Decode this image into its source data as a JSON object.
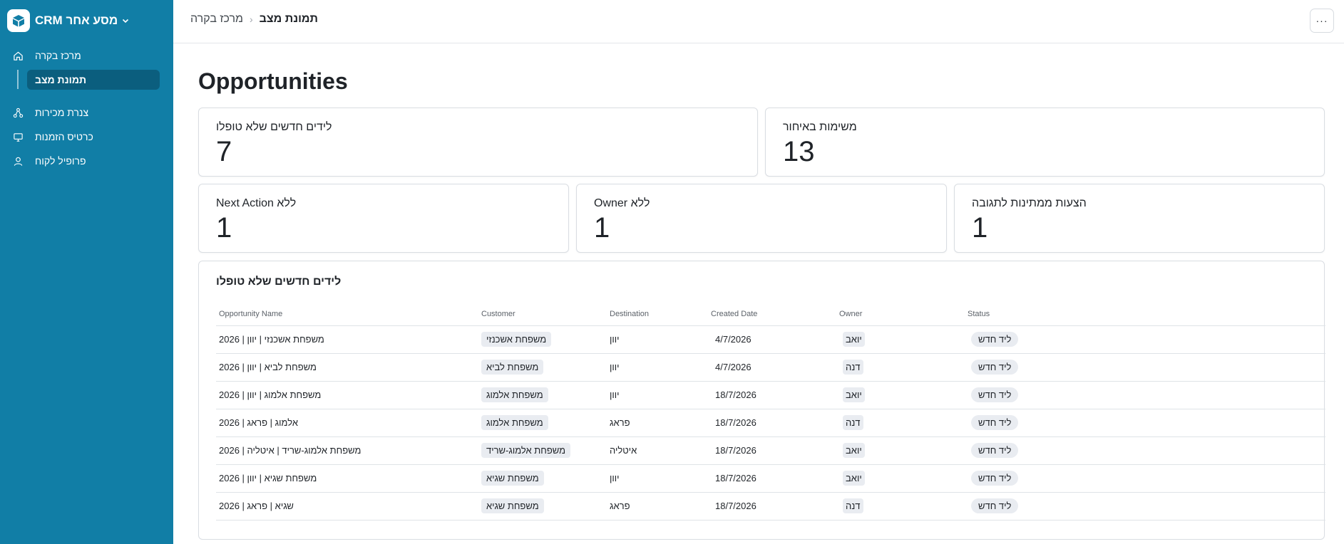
{
  "app": {
    "name": "CRM מסע אחר"
  },
  "sidebar": {
    "items": [
      {
        "label": "מרכז בקרה",
        "icon": "home-icon"
      },
      {
        "label": "תמונת מצב",
        "icon": "",
        "active": true
      },
      {
        "label": "צנרת מכירות",
        "icon": "pipeline-icon"
      },
      {
        "label": "כרטיס הזמנות",
        "icon": "monitor-icon"
      },
      {
        "label": "פרופיל לקוח",
        "icon": "user-icon"
      }
    ]
  },
  "header": {
    "breadcrumb_parent": "מרכז בקרה",
    "breadcrumb_current": "תמונת מצב",
    "more_label": "···"
  },
  "main": {
    "title": "Opportunities",
    "kpis": [
      {
        "label": "לידים חדשים שלא טופלו",
        "value": "7"
      },
      {
        "label": "משימות באיחור",
        "value": "13"
      },
      {
        "label": "ללא Next Action",
        "value": "1"
      },
      {
        "label": "ללא Owner",
        "value": "1"
      },
      {
        "label": "הצעות ממתינות לתגובה",
        "value": "1"
      }
    ],
    "table": {
      "title": "לידים חדשים שלא טופלו",
      "columns": [
        "Opportunity Name",
        "Customer",
        "Destination",
        "Created Date",
        "Owner",
        "Status"
      ],
      "rows": [
        {
          "name": "משפחת אשכנזי | יוון | 2026",
          "customer": "משפחת אשכנזי",
          "destination": "יוון",
          "created": "4/7/2026",
          "owner": "יואב",
          "status": "ליד חדש"
        },
        {
          "name": "משפחת לביא | יוון | 2026",
          "customer": "משפחת לביא",
          "destination": "יוון",
          "created": "4/7/2026",
          "owner": "דנה",
          "status": "ליד חדש"
        },
        {
          "name": "משפחת אלמוג | יוון | 2026",
          "customer": "משפחת אלמוג",
          "destination": "יוון",
          "created": "18/7/2026",
          "owner": "יואב",
          "status": "ליד חדש"
        },
        {
          "name": "אלמוג | פראג | 2026",
          "customer": "משפחת אלמוג",
          "destination": "פראג",
          "created": "18/7/2026",
          "owner": "דנה",
          "status": "ליד חדש"
        },
        {
          "name": "משפחת אלמוג-שריד | איטליה | 2026",
          "customer": "משפחת אלמוג-שריד",
          "destination": "איטליה",
          "created": "18/7/2026",
          "owner": "יואב",
          "status": "ליד חדש"
        },
        {
          "name": "משפחת שגיא | יוון | 2026",
          "customer": "משפחת שגיא",
          "destination": "יוון",
          "created": "18/7/2026",
          "owner": "יואב",
          "status": "ליד חדש"
        },
        {
          "name": "שגיא | פראג | 2026",
          "customer": "משפחת שגיא",
          "destination": "פראג",
          "created": "18/7/2026",
          "owner": "דנה",
          "status": "ליד חדש"
        }
      ]
    }
  },
  "colors": {
    "sidebar_bg": "#117ea6",
    "sidebar_active_bg": "#0b5e7e",
    "chip_bg": "#e9ecf1",
    "border": "#d9dde2"
  }
}
